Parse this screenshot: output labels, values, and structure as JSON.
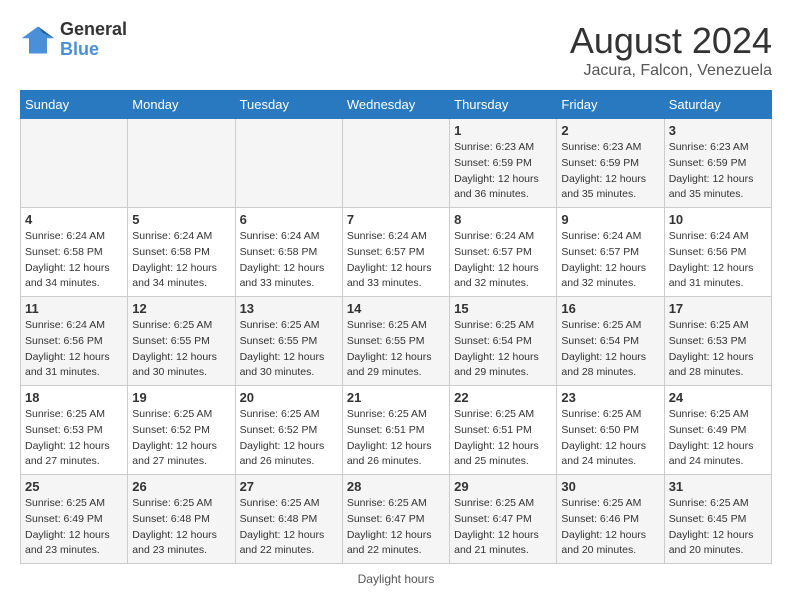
{
  "header": {
    "logo_line1": "General",
    "logo_line2": "Blue",
    "month_year": "August 2024",
    "location": "Jacura, Falcon, Venezuela"
  },
  "days_of_week": [
    "Sunday",
    "Monday",
    "Tuesday",
    "Wednesday",
    "Thursday",
    "Friday",
    "Saturday"
  ],
  "weeks": [
    [
      {
        "day": "",
        "sunrise": "",
        "sunset": "",
        "daylight": ""
      },
      {
        "day": "",
        "sunrise": "",
        "sunset": "",
        "daylight": ""
      },
      {
        "day": "",
        "sunrise": "",
        "sunset": "",
        "daylight": ""
      },
      {
        "day": "",
        "sunrise": "",
        "sunset": "",
        "daylight": ""
      },
      {
        "day": "1",
        "sunrise": "6:23 AM",
        "sunset": "6:59 PM",
        "daylight": "12 hours and 36 minutes."
      },
      {
        "day": "2",
        "sunrise": "6:23 AM",
        "sunset": "6:59 PM",
        "daylight": "12 hours and 35 minutes."
      },
      {
        "day": "3",
        "sunrise": "6:23 AM",
        "sunset": "6:59 PM",
        "daylight": "12 hours and 35 minutes."
      }
    ],
    [
      {
        "day": "4",
        "sunrise": "6:24 AM",
        "sunset": "6:58 PM",
        "daylight": "12 hours and 34 minutes."
      },
      {
        "day": "5",
        "sunrise": "6:24 AM",
        "sunset": "6:58 PM",
        "daylight": "12 hours and 34 minutes."
      },
      {
        "day": "6",
        "sunrise": "6:24 AM",
        "sunset": "6:58 PM",
        "daylight": "12 hours and 33 minutes."
      },
      {
        "day": "7",
        "sunrise": "6:24 AM",
        "sunset": "6:57 PM",
        "daylight": "12 hours and 33 minutes."
      },
      {
        "day": "8",
        "sunrise": "6:24 AM",
        "sunset": "6:57 PM",
        "daylight": "12 hours and 32 minutes."
      },
      {
        "day": "9",
        "sunrise": "6:24 AM",
        "sunset": "6:57 PM",
        "daylight": "12 hours and 32 minutes."
      },
      {
        "day": "10",
        "sunrise": "6:24 AM",
        "sunset": "6:56 PM",
        "daylight": "12 hours and 31 minutes."
      }
    ],
    [
      {
        "day": "11",
        "sunrise": "6:24 AM",
        "sunset": "6:56 PM",
        "daylight": "12 hours and 31 minutes."
      },
      {
        "day": "12",
        "sunrise": "6:25 AM",
        "sunset": "6:55 PM",
        "daylight": "12 hours and 30 minutes."
      },
      {
        "day": "13",
        "sunrise": "6:25 AM",
        "sunset": "6:55 PM",
        "daylight": "12 hours and 30 minutes."
      },
      {
        "day": "14",
        "sunrise": "6:25 AM",
        "sunset": "6:55 PM",
        "daylight": "12 hours and 29 minutes."
      },
      {
        "day": "15",
        "sunrise": "6:25 AM",
        "sunset": "6:54 PM",
        "daylight": "12 hours and 29 minutes."
      },
      {
        "day": "16",
        "sunrise": "6:25 AM",
        "sunset": "6:54 PM",
        "daylight": "12 hours and 28 minutes."
      },
      {
        "day": "17",
        "sunrise": "6:25 AM",
        "sunset": "6:53 PM",
        "daylight": "12 hours and 28 minutes."
      }
    ],
    [
      {
        "day": "18",
        "sunrise": "6:25 AM",
        "sunset": "6:53 PM",
        "daylight": "12 hours and 27 minutes."
      },
      {
        "day": "19",
        "sunrise": "6:25 AM",
        "sunset": "6:52 PM",
        "daylight": "12 hours and 27 minutes."
      },
      {
        "day": "20",
        "sunrise": "6:25 AM",
        "sunset": "6:52 PM",
        "daylight": "12 hours and 26 minutes."
      },
      {
        "day": "21",
        "sunrise": "6:25 AM",
        "sunset": "6:51 PM",
        "daylight": "12 hours and 26 minutes."
      },
      {
        "day": "22",
        "sunrise": "6:25 AM",
        "sunset": "6:51 PM",
        "daylight": "12 hours and 25 minutes."
      },
      {
        "day": "23",
        "sunrise": "6:25 AM",
        "sunset": "6:50 PM",
        "daylight": "12 hours and 24 minutes."
      },
      {
        "day": "24",
        "sunrise": "6:25 AM",
        "sunset": "6:49 PM",
        "daylight": "12 hours and 24 minutes."
      }
    ],
    [
      {
        "day": "25",
        "sunrise": "6:25 AM",
        "sunset": "6:49 PM",
        "daylight": "12 hours and 23 minutes."
      },
      {
        "day": "26",
        "sunrise": "6:25 AM",
        "sunset": "6:48 PM",
        "daylight": "12 hours and 23 minutes."
      },
      {
        "day": "27",
        "sunrise": "6:25 AM",
        "sunset": "6:48 PM",
        "daylight": "12 hours and 22 minutes."
      },
      {
        "day": "28",
        "sunrise": "6:25 AM",
        "sunset": "6:47 PM",
        "daylight": "12 hours and 22 minutes."
      },
      {
        "day": "29",
        "sunrise": "6:25 AM",
        "sunset": "6:47 PM",
        "daylight": "12 hours and 21 minutes."
      },
      {
        "day": "30",
        "sunrise": "6:25 AM",
        "sunset": "6:46 PM",
        "daylight": "12 hours and 20 minutes."
      },
      {
        "day": "31",
        "sunrise": "6:25 AM",
        "sunset": "6:45 PM",
        "daylight": "12 hours and 20 minutes."
      }
    ]
  ],
  "footer": {
    "text": "Daylight hours"
  }
}
